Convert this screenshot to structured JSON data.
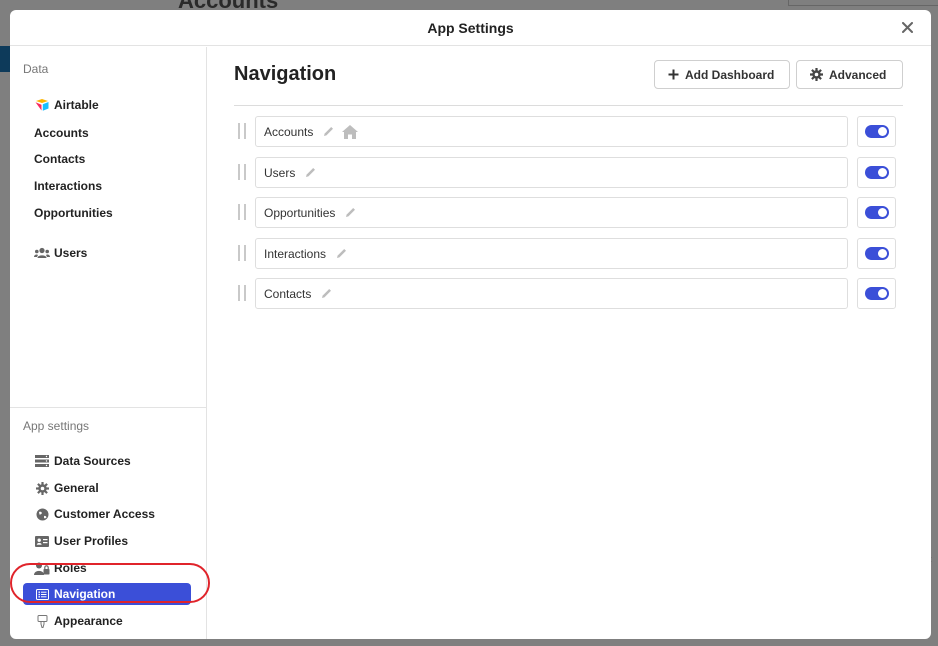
{
  "background": {
    "title": "Accounts"
  },
  "modal": {
    "title": "App Settings"
  },
  "sidebar": {
    "data_label": "Data",
    "data_items": [
      {
        "label": "Airtable",
        "icon": "airtable-icon"
      },
      {
        "label": "Accounts"
      },
      {
        "label": "Contacts"
      },
      {
        "label": "Interactions"
      },
      {
        "label": "Opportunities"
      }
    ],
    "users_label": "Users",
    "app_settings_label": "App settings",
    "settings_items": [
      {
        "label": "Data Sources",
        "icon": "database-icon"
      },
      {
        "label": "General",
        "icon": "gear-icon"
      },
      {
        "label": "Customer Access",
        "icon": "globe-icon"
      },
      {
        "label": "User Profiles",
        "icon": "id-card-icon"
      },
      {
        "label": "Roles",
        "icon": "user-lock-icon"
      },
      {
        "label": "Navigation",
        "icon": "list-icon",
        "active": true
      },
      {
        "label": "Appearance",
        "icon": "brush-icon"
      }
    ]
  },
  "main": {
    "title": "Navigation",
    "add_dashboard_label": "Add Dashboard",
    "advanced_label": "Advanced",
    "rows": [
      {
        "label": "Accounts",
        "enabled": true,
        "home": true
      },
      {
        "label": "Users",
        "enabled": true
      },
      {
        "label": "Opportunities",
        "enabled": true
      },
      {
        "label": "Interactions",
        "enabled": true
      },
      {
        "label": "Contacts",
        "enabled": true
      }
    ]
  },
  "colors": {
    "accent": "#3b4fd8",
    "highlight_ring": "#e0242b"
  }
}
